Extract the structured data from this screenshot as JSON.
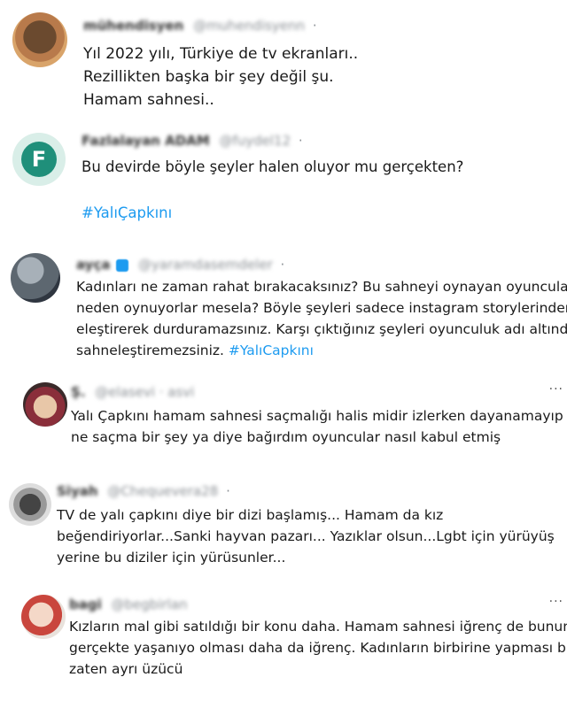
{
  "tweets": [
    {
      "name": "mühendisyen",
      "handle": "@muhendisyenn",
      "lines": [
        "Yıl 2022 yılı, Türkiye de tv ekranları..",
        "Rezillikten başka bir şey değil şu.",
        "Hamam sahnesi.."
      ]
    },
    {
      "name": "Fazlalayan ADAM",
      "handle": "@fuydel12",
      "lines": [
        "Bu devirde böyle şeyler halen oluyor mu gerçekten?"
      ],
      "hashtag": "#YalıÇapkını",
      "avatar_letter": "F"
    },
    {
      "name": "ayça",
      "handle": "@yaramdasemdeler",
      "lines": [
        "Kadınları ne zaman rahat bırakacaksınız? Bu sahneyi oynayan oyuncular",
        "neden oynuyorlar mesela? Böyle şeyleri sadece instagram storylerinden",
        "eleştirerek durduramazsınız. Karşı çıktığınız şeyleri oyunculuk adı altında",
        "sahneleştiremezsiniz."
      ],
      "hashtag": "#YalıCapkını"
    },
    {
      "name": "Ş.",
      "handle": "@elasevi · asvi",
      "lines": [
        "Yalı Çapkını hamam sahnesi saçmalığı halis midir izlerken dayanamayıp bu",
        "ne saçma bir şey ya diye bağırdım oyuncular nasıl kabul etmiş"
      ]
    },
    {
      "name": "Siyah",
      "handle": "@Chequevera28",
      "lines": [
        "TV de yalı çapkını diye bir dizi başlamış... Hamam da kız",
        "beğendiriyorlar...Sanki hayvan pazarı... Yazıklar olsun...Lgbt için yürüyüş",
        "yerine bu diziler için yürüsunler..."
      ]
    },
    {
      "name": "bagi",
      "handle": "@begbirlan",
      "lines": [
        "Kızların mal gibi satıldığı bir konu daha. Hamam sahnesi iğrenç de bunun",
        "gerçekte yaşanıyo olması daha da iğrenç. Kadınların birbirine yapması bunu",
        "zaten ayrı üzücü"
      ]
    }
  ],
  "more_label": "···",
  "dot": "·"
}
